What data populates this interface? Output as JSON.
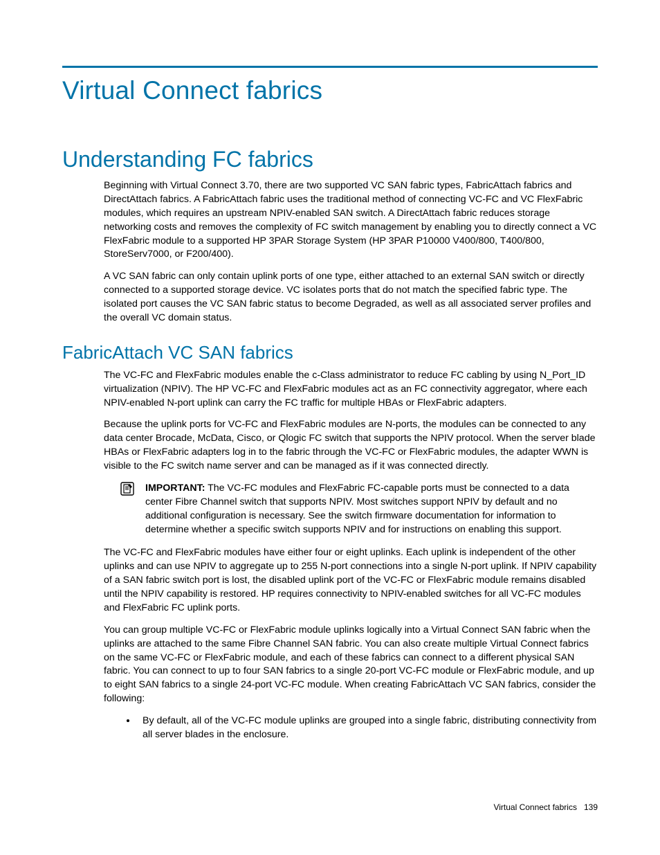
{
  "title": "Virtual Connect fabrics",
  "section": {
    "heading": "Understanding FC fabrics",
    "p1": "Beginning with Virtual Connect 3.70, there are two supported VC SAN fabric types, FabricAttach fabrics and DirectAttach fabrics. A FabricAttach fabric uses the traditional method of connecting VC-FC and VC FlexFabric modules, which requires an upstream NPIV-enabled SAN switch. A DirectAttach fabric reduces storage networking costs and removes the complexity of FC switch management by enabling you to directly connect a VC FlexFabric module to a supported HP 3PAR Storage System (HP 3PAR P10000 V400/800, T400/800, StoreServ7000, or F200/400).",
    "p2": "A VC SAN fabric can only contain uplink ports of one type, either attached to an external SAN switch or directly connected to a supported storage device. VC isolates ports that do not match the specified fabric type. The isolated port causes the VC SAN fabric status to become Degraded, as well as all associated server profiles and the overall VC domain status."
  },
  "subsection": {
    "heading": "FabricAttach VC SAN fabrics",
    "p1": "The VC-FC and FlexFabric modules enable the c-Class administrator to reduce FC cabling by using N_Port_ID virtualization (NPIV). The HP VC-FC and FlexFabric modules act as an FC connectivity aggregator, where each NPIV-enabled N-port uplink can carry the FC traffic for multiple HBAs or FlexFabric adapters.",
    "p2": "Because the uplink ports for VC-FC and FlexFabric modules are N-ports, the modules can be connected to any data center Brocade, McData, Cisco, or Qlogic FC switch that supports the NPIV protocol. When the server blade HBAs or FlexFabric adapters log in to the fabric through the VC-FC or FlexFabric modules, the adapter WWN is visible to the FC switch name server and can be managed as if it was connected directly.",
    "important_label": "IMPORTANT:",
    "important_text": "   The VC-FC modules and FlexFabric FC-capable ports must be connected to a data center Fibre Channel switch that supports NPIV. Most switches support NPIV by default and no additional configuration is necessary. See the switch firmware documentation for information to determine whether a specific switch supports NPIV and for instructions on enabling this support.",
    "p3": "The VC-FC and FlexFabric modules have either four or eight uplinks. Each uplink is independent of the other uplinks and can use NPIV to aggregate up to 255 N-port connections into a single N-port uplink. If NPIV capability of a SAN fabric switch port is lost, the disabled uplink port of the VC-FC or FlexFabric module remains disabled until the NPIV capability is restored. HP requires connectivity to NPIV-enabled switches for all VC-FC modules and FlexFabric FC uplink ports.",
    "p4": "You can group multiple VC-FC or FlexFabric module uplinks logically into a Virtual Connect SAN fabric when the uplinks are attached to the same Fibre Channel SAN fabric. You can also create multiple Virtual Connect fabrics on the same VC-FC or FlexFabric module, and each of these fabrics can connect to a different physical SAN fabric. You can connect to up to four SAN fabrics to a single 20-port VC-FC module or FlexFabric module, and up to eight SAN fabrics to a single 24-port VC-FC module. When creating FabricAttach VC SAN fabrics, consider the following:",
    "bullet1": "By default, all of the VC-FC module uplinks are grouped into a single fabric, distributing connectivity from all server blades in the enclosure."
  },
  "footer": {
    "text": "Virtual Connect fabrics",
    "page": "139"
  }
}
